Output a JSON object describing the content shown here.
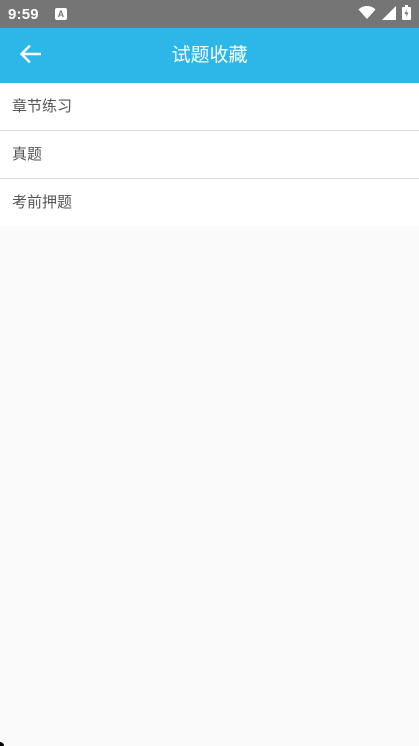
{
  "status_bar": {
    "time": "9:59",
    "notification_letter": "A",
    "icons": [
      "wifi-icon",
      "signal-icon",
      "battery-icon"
    ]
  },
  "app_bar": {
    "title": "试题收藏",
    "back_icon": "arrow-left-icon",
    "color": "#2cb7e8"
  },
  "list": {
    "items": [
      {
        "label": "章节练习"
      },
      {
        "label": "真题"
      },
      {
        "label": "考前押题"
      }
    ]
  }
}
